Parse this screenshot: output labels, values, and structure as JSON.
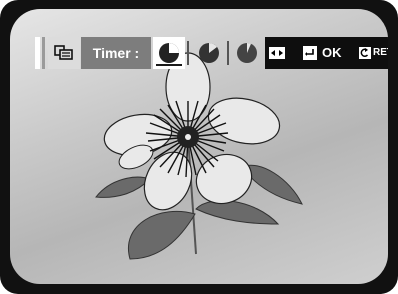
{
  "osd": {
    "label": "Timer :",
    "selected_option": 1,
    "options": [
      "timer-option-1",
      "timer-option-2",
      "timer-option-3"
    ],
    "ok_label": "OK",
    "return_label": "RETURN",
    "icons": [
      "display-mode-icon",
      "left-right-arrow-icon",
      "enter-icon",
      "return-icon"
    ]
  },
  "colors": {
    "osd_bg": "#7d7d7d",
    "osd_black": "#0e0e0e",
    "selected": "#ffffff"
  }
}
